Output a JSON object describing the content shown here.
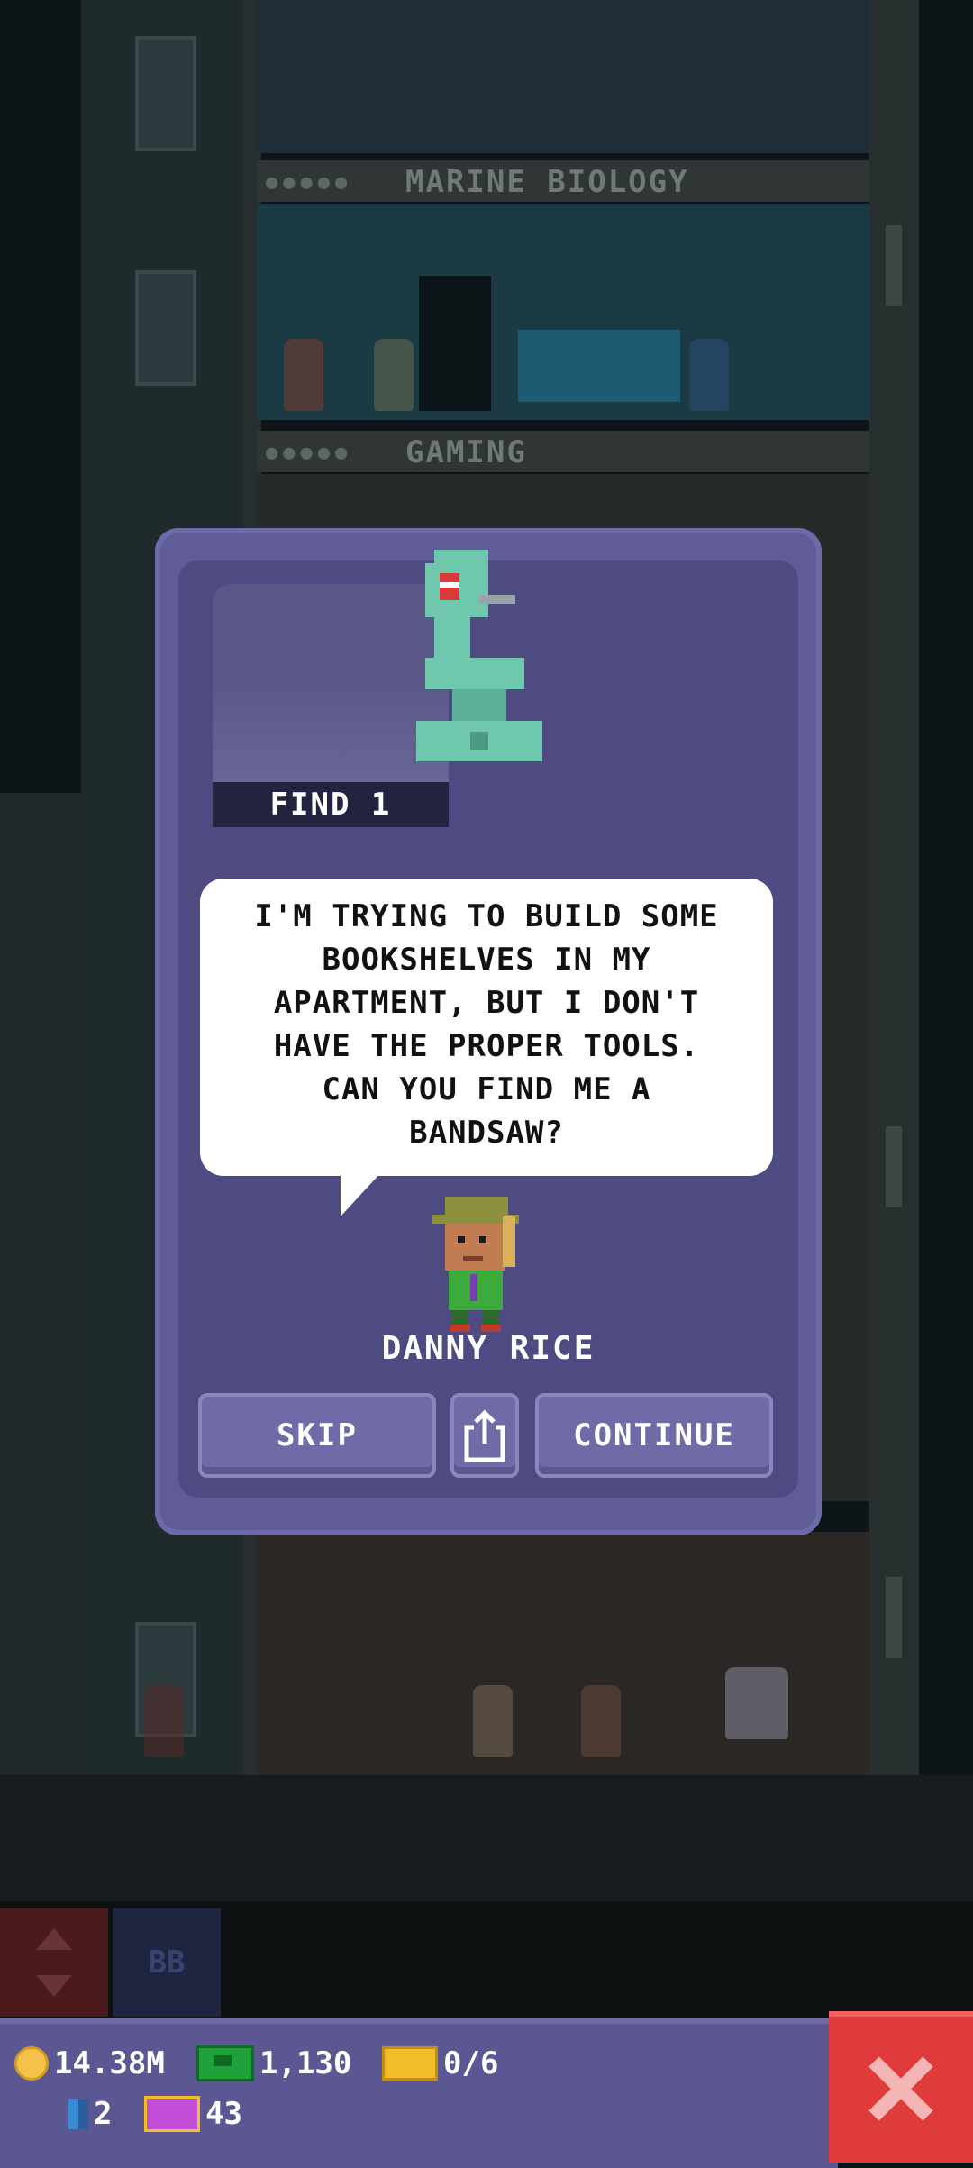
{
  "background": {
    "floors": [
      {
        "label": "MARINE BIOLOGY"
      },
      {
        "label": "GAMING"
      }
    ],
    "toolbar": {
      "bb_label": "BB"
    }
  },
  "dialog": {
    "mission_item_icon": "bandsaw-icon",
    "find_label": "FIND 1",
    "speech": "I'M TRYING TO BUILD SOME BOOKSHELVES IN MY APARTMENT, BUT I DON'T HAVE THE PROPER TOOLS. CAN YOU FIND ME A BANDSAW?",
    "speech_lines": [
      "I'M TRYING TO BUILD SOME",
      "BOOKSHELVES IN MY",
      "APARTMENT, BUT I DON'T",
      "HAVE THE PROPER TOOLS.",
      "CAN YOU FIND ME A",
      "BANDSAW?"
    ],
    "character_name": "DANNY RICE",
    "buttons": {
      "skip": "SKIP",
      "share_icon": "share-icon",
      "continue": "CONTINUE"
    }
  },
  "status": {
    "coins": "14.38M",
    "bux": "1,130",
    "tickets": "0/6",
    "keys": "2",
    "vip": "43"
  },
  "colors": {
    "dialog_frame": "#5f5c98",
    "dialog_body": "#4e4b82",
    "button": "#6e6ba6",
    "close_button": "#e03b3b",
    "coin": "#f6c14b",
    "bux": "#20a23a"
  }
}
